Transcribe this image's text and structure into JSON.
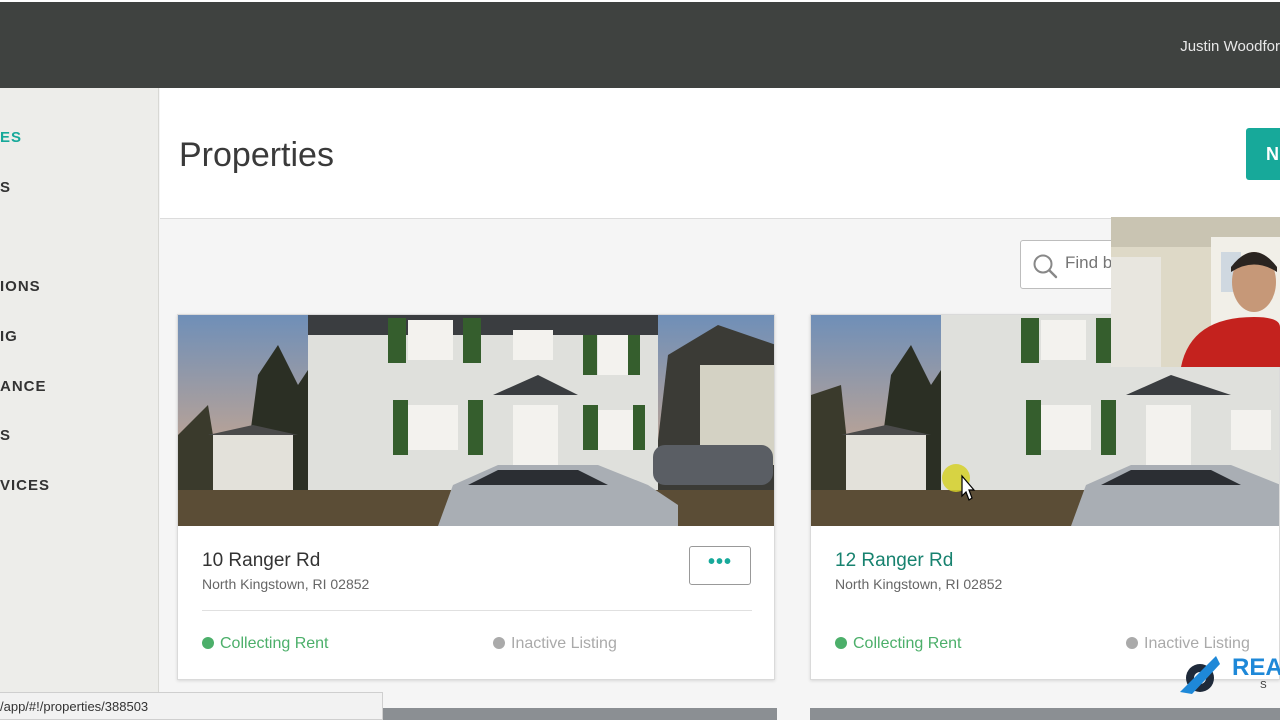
{
  "topbar": {
    "user_name": "Justin Woodfor"
  },
  "sidebar": {
    "items": [
      {
        "label": "ES",
        "active": true
      },
      {
        "label": "S"
      },
      {
        "label": "IONS"
      },
      {
        "label": "IG"
      },
      {
        "label": "ANCE"
      },
      {
        "label": "S"
      },
      {
        "label": "VICES"
      }
    ]
  },
  "header": {
    "title": "Properties",
    "new_button_label": "N"
  },
  "search": {
    "placeholder": "Find b"
  },
  "cards": [
    {
      "address": "10 Ranger Rd",
      "city": "North Kingstown, RI 02852",
      "status_collecting": "Collecting Rent",
      "status_listing": "Inactive Listing",
      "more_label": "•••"
    },
    {
      "address": "12 Ranger Rd",
      "city": "North Kingstown, RI 02852",
      "status_collecting": "Collecting Rent",
      "status_listing": "Inactive Listing"
    }
  ],
  "status_bar": {
    "url": "/app/#!/properties/388503"
  },
  "watermark": {
    "text": "REAI",
    "sub": "S"
  },
  "colors": {
    "accent": "#17a99a",
    "topbar": "#3f4240",
    "status_green": "#4caf6a",
    "status_gray": "#aaaaaa"
  }
}
